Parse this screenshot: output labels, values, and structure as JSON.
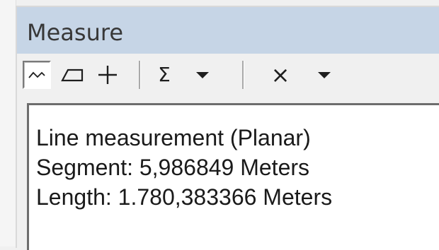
{
  "window": {
    "title": "Measure"
  },
  "toolbar": {
    "buttons": [
      {
        "name": "measure-line",
        "icon": "polyline-icon",
        "pressed": true
      },
      {
        "name": "measure-area",
        "icon": "polygon-icon",
        "pressed": false
      },
      {
        "name": "measure-feature",
        "icon": "plus-icon",
        "pressed": false
      },
      {
        "name": "show-total",
        "icon": "sigma-icon",
        "glyph": "Σ",
        "pressed": false
      },
      {
        "name": "units-dropdown",
        "icon": "chevron-down-icon",
        "pressed": false
      },
      {
        "name": "clear",
        "icon": "close-icon",
        "glyph": "×",
        "pressed": false
      },
      {
        "name": "clear-dropdown",
        "icon": "chevron-down-icon",
        "pressed": false
      }
    ]
  },
  "results": {
    "mode": "Line measurement (Planar)",
    "segment": "Segment: 5,986849 Meters",
    "length": "Length: 1.780,383366 Meters"
  },
  "colors": {
    "titlebar": "#c6d5e6",
    "panel": "#f0f0f0",
    "content_bg": "#ffffff"
  }
}
